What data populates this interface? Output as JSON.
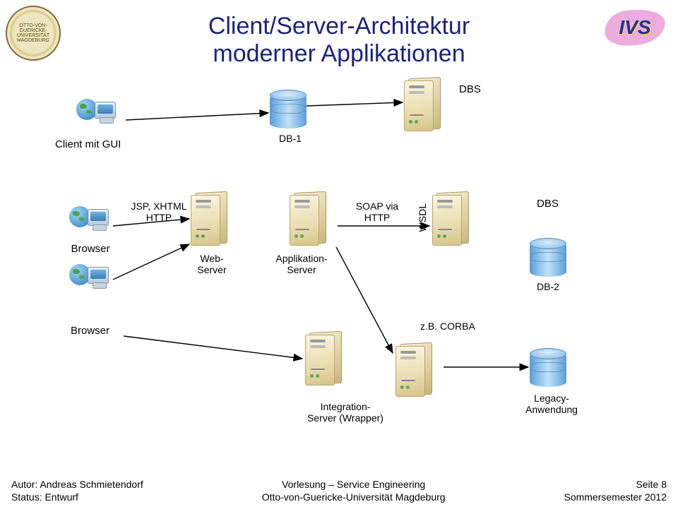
{
  "title_line1": "Client/Server-Architektur",
  "title_line2": "moderner Applikationen",
  "seal_text": "OTTO-VON-GUERICKE-UNIVERSITÄT MAGDEBURG",
  "ivs": "IVS",
  "nodes": {
    "client_gui": "Client mit GUI",
    "db1": "DB-1",
    "dbs_top": "DBS",
    "browser1": "Browser",
    "jsp": "JSP, XHTML\nHTTP",
    "webserver": "Web-\nServer",
    "appserver": "Applikation-\nServer",
    "soap": "SOAP via\nHTTP",
    "wsdl": "WSDL",
    "dbs_right": "DBS",
    "db2": "DB-2",
    "browser2": "Browser",
    "corba": "z.B. CORBA",
    "intserver": "Integration-\nServer (Wrapper)",
    "legacy": "Legacy-\nAnwendung"
  },
  "footer": {
    "author": "Autor: Andreas Schmietendorf",
    "status": "Status: Entwurf",
    "lecture": "Vorlesung – Service Engineering",
    "uni": "Otto-von-Guericke-Universität Magdeburg",
    "page": "Seite 8",
    "term": "Sommersemester 2012"
  }
}
